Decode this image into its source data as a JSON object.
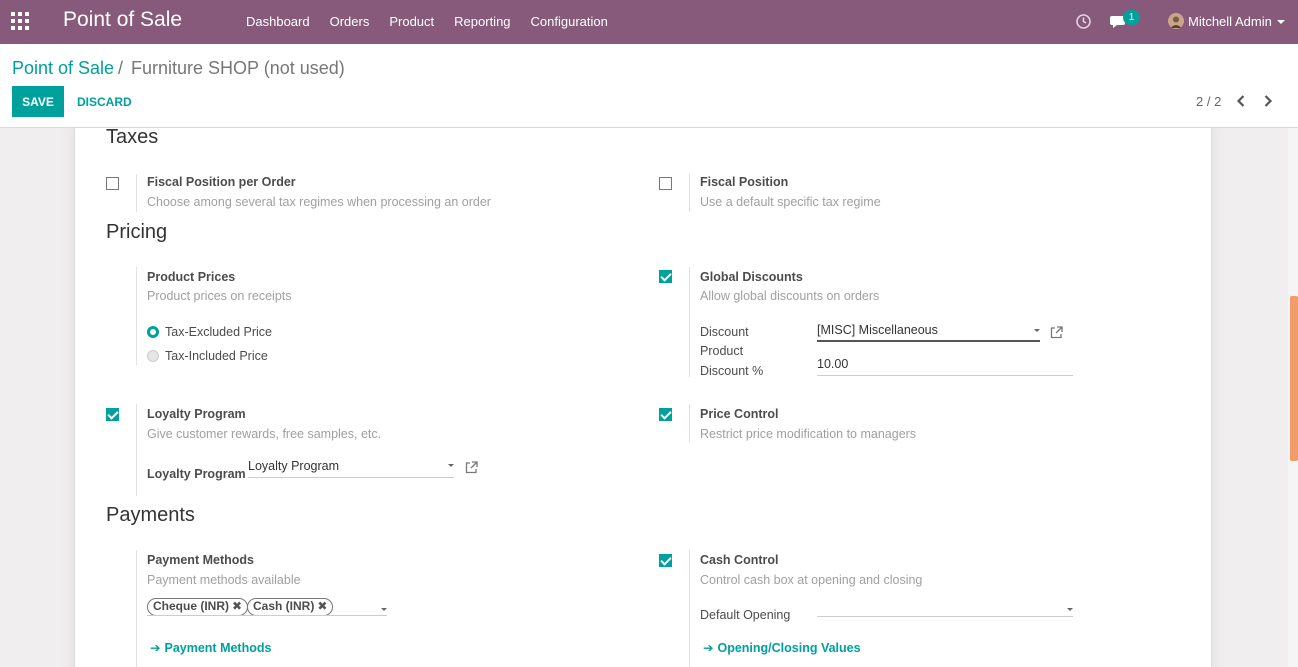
{
  "navbar": {
    "app_title": "Point of Sale",
    "menu": [
      "Dashboard",
      "Orders",
      "Product",
      "Reporting",
      "Configuration"
    ],
    "chat_badge": "1",
    "user_name": "Mitchell Admin",
    "color": "#875a7b"
  },
  "breadcrumb": {
    "root": "Point of Sale",
    "separator": "/",
    "current": "Furniture SHOP (not used)"
  },
  "buttons": {
    "save": "SAVE",
    "discard": "DISCARD"
  },
  "pager": {
    "value": "2 / 2"
  },
  "accent_color": "#00a09d",
  "sections": {
    "taxes": {
      "title": "Taxes",
      "fiscal_position_per_order": {
        "label": "Fiscal Position per Order",
        "help": "Choose among several tax regimes when processing an order",
        "checked": false
      },
      "fiscal_position": {
        "label": "Fiscal Position",
        "help": "Use a default specific tax regime",
        "checked": false
      }
    },
    "pricing": {
      "title": "Pricing",
      "product_prices": {
        "label": "Product Prices",
        "help": "Product prices on receipts",
        "options": [
          "Tax-Excluded Price",
          "Tax-Included Price"
        ],
        "selected": "Tax-Excluded Price"
      },
      "global_discounts": {
        "label": "Global Discounts",
        "help": "Allow global discounts on orders",
        "checked": true,
        "discount_product_label_1": "Discount",
        "discount_product_label_2": "Product",
        "discount_product_value": "[MISC] Miscellaneous",
        "discount_percent_label": "Discount %",
        "discount_percent_value": "10.00"
      },
      "loyalty_program": {
        "label": "Loyalty Program",
        "help": "Give customer rewards, free samples, etc.",
        "checked": true,
        "field_label": "Loyalty Program",
        "field_value": "Loyalty Program"
      },
      "price_control": {
        "label": "Price Control",
        "help": "Restrict price modification to managers",
        "checked": true
      }
    },
    "payments": {
      "title": "Payments",
      "payment_methods": {
        "label": "Payment Methods",
        "help": "Payment methods available",
        "tags": [
          "Cheque (INR)",
          "Cash (INR)"
        ],
        "link": "Payment Methods"
      },
      "cash_control": {
        "label": "Cash Control",
        "help": "Control cash box at opening and closing",
        "checked": true,
        "default_opening_label": "Default Opening",
        "default_opening_value": "",
        "link": "Opening/Closing Values"
      }
    }
  }
}
